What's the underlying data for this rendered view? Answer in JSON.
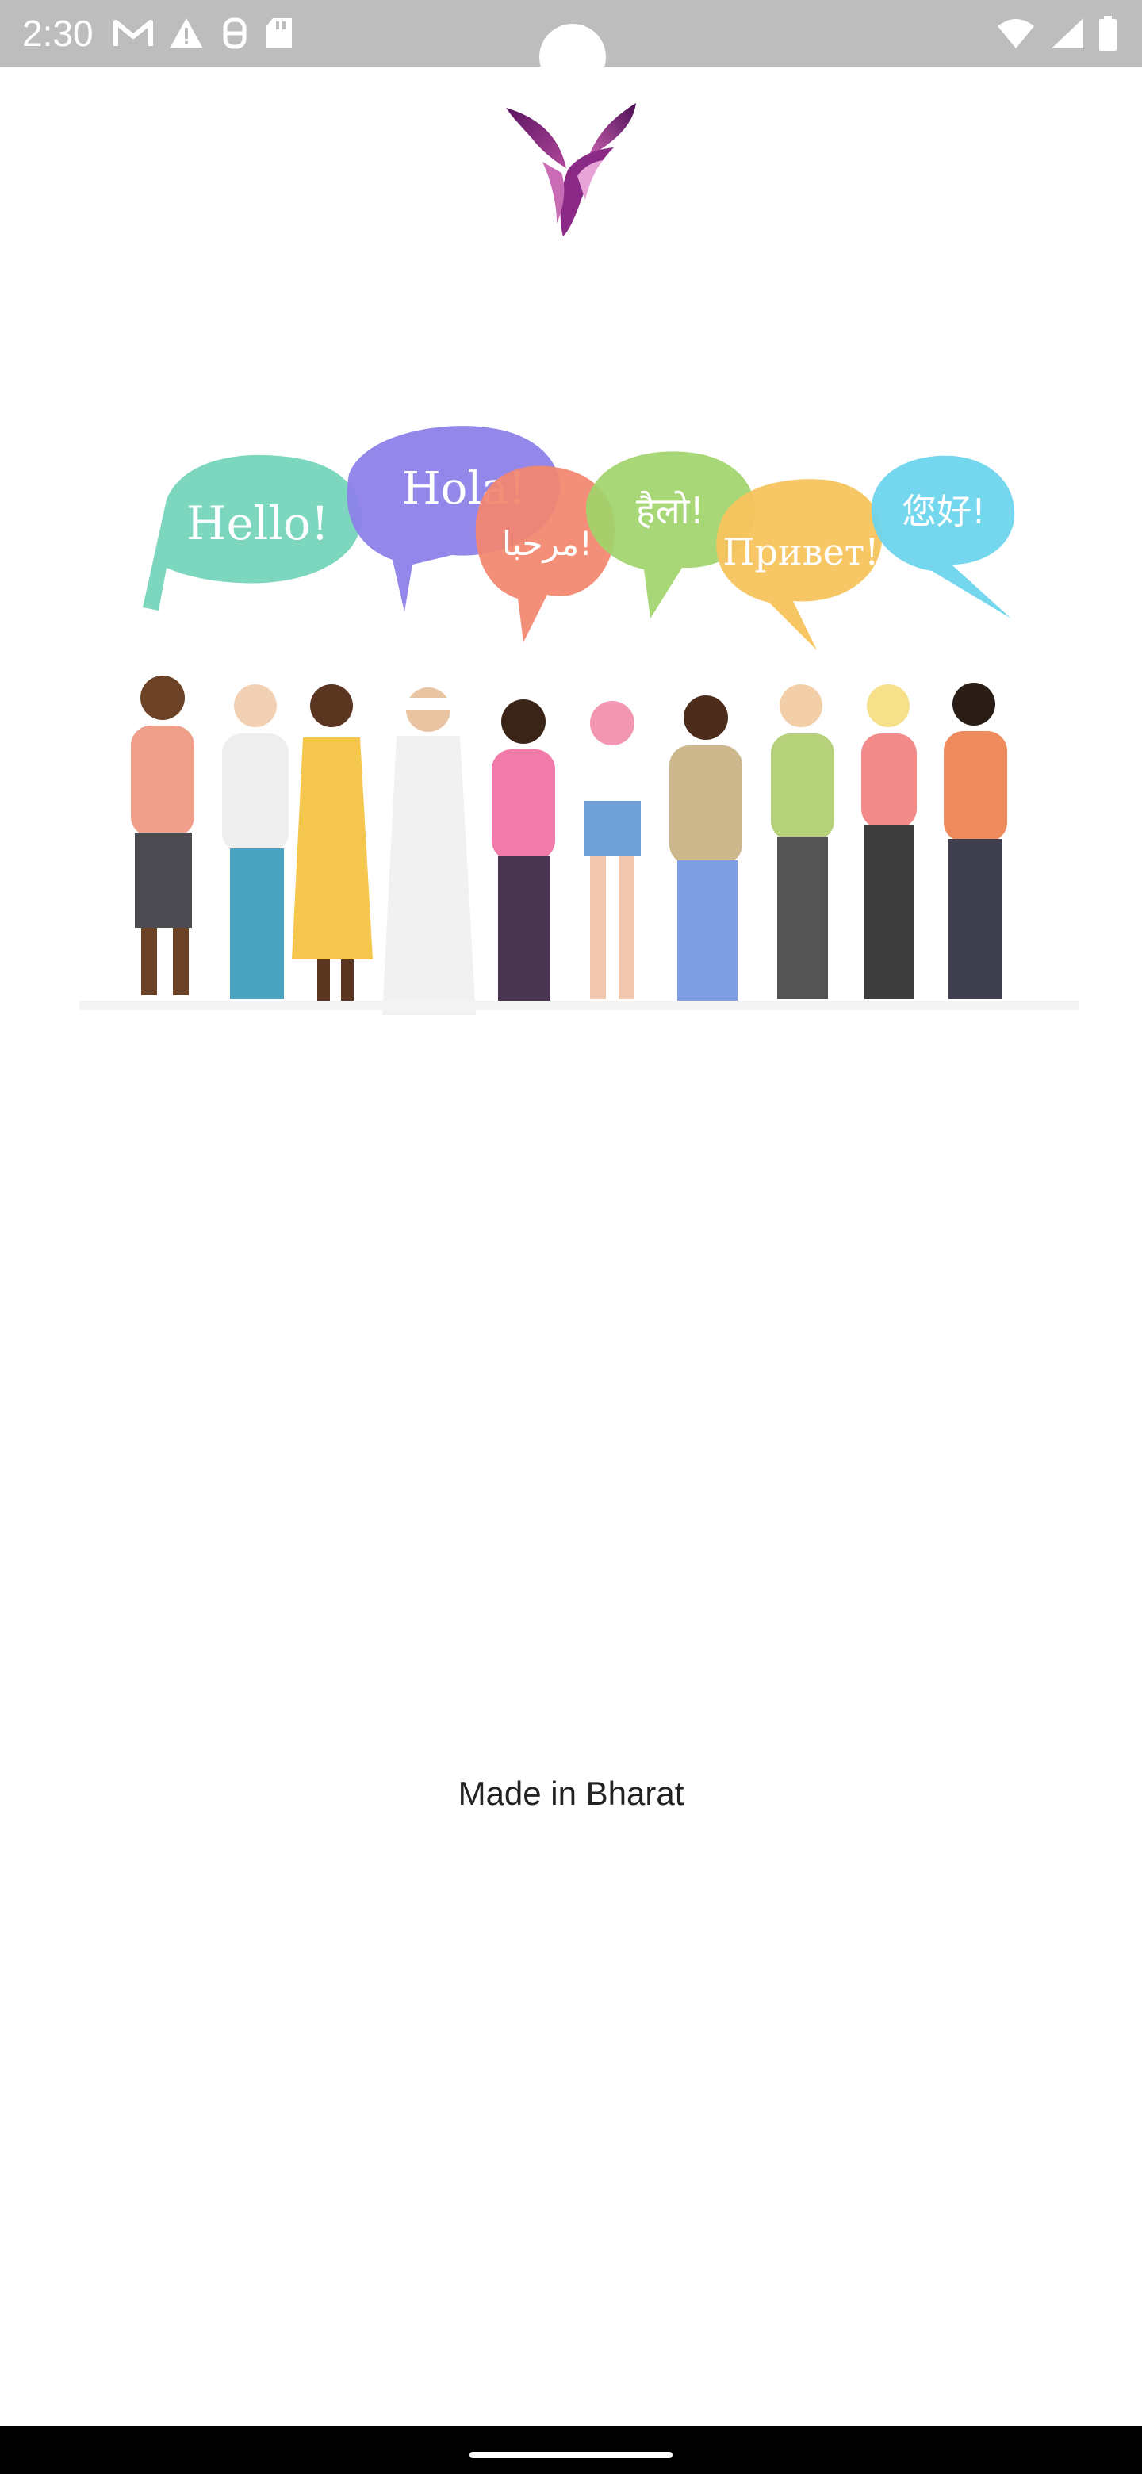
{
  "status_bar": {
    "time": "2:30",
    "left_icons": [
      "gmail-icon",
      "warning-icon",
      "sync-icon",
      "sd-card-icon"
    ],
    "right_icons": [
      "wifi-icon",
      "signal-icon",
      "battery-icon"
    ]
  },
  "illustration": {
    "greetings": [
      "Hello!",
      "Hola!",
      "مرحبا!",
      "हैलो!",
      "Привет!",
      "您好!"
    ]
  },
  "footer": {
    "made_in": "Made in Bharat"
  },
  "colors": {
    "status_bar": "#bdbdbd",
    "logo_primary": "#7b1f7a",
    "nav_bar": "#000000"
  }
}
